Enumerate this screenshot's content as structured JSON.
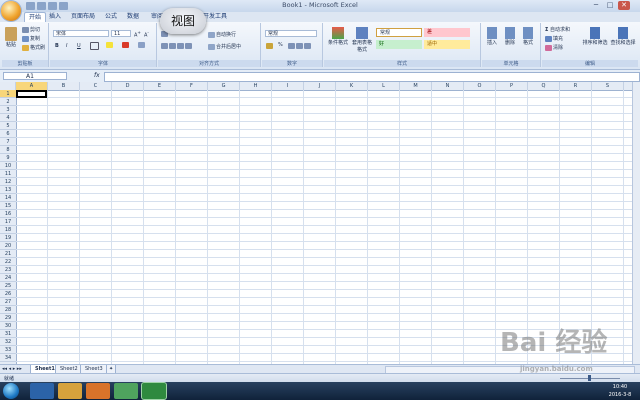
{
  "window": {
    "title": "Book1 - Microsoft Excel",
    "min": "─",
    "max": "□",
    "close": "✕"
  },
  "tabs": [
    "开始",
    "插入",
    "页面布局",
    "公式",
    "数据",
    "审阅",
    "视图",
    "开发工具"
  ],
  "tooltip": "视图",
  "ribbon": {
    "clipboard": {
      "paste": "粘贴",
      "cut": "剪切",
      "copy": "复制",
      "format_painter": "格式刷",
      "label": "剪贴板"
    },
    "font": {
      "name": "宋体",
      "size": "11",
      "bold": "B",
      "italic": "I",
      "underline": "U",
      "label": "字体"
    },
    "alignment": {
      "wrap": "自动换行",
      "merge": "合并后居中",
      "label": "对齐方式"
    },
    "number": {
      "format": "常规",
      "percent": "%",
      "label": "数字"
    },
    "styles": {
      "conditional": "条件格式",
      "table": "套用表格格式",
      "normal": "常规",
      "bad": "差",
      "good": "好",
      "neutral": "适中",
      "label": "样式"
    },
    "cells": {
      "insert": "插入",
      "delete": "删除",
      "format": "格式",
      "label": "单元格"
    },
    "editing": {
      "autosum": "自动求和",
      "fill": "填充",
      "clear": "清除",
      "sort": "排序和筛选",
      "find": "查找和选择",
      "label": "编辑"
    }
  },
  "formula_bar": {
    "name_box": "A1",
    "fx": "fx",
    "value": ""
  },
  "columns": [
    "A",
    "B",
    "C",
    "D",
    "E",
    "F",
    "G",
    "H",
    "I",
    "J",
    "K",
    "L",
    "M",
    "N",
    "O",
    "P",
    "Q",
    "R",
    "S"
  ],
  "rows": [
    "1",
    "2",
    "3",
    "4",
    "5",
    "6",
    "7",
    "8",
    "9",
    "10",
    "11",
    "12",
    "13",
    "14",
    "15",
    "16",
    "17",
    "18",
    "19",
    "20",
    "21",
    "22",
    "23",
    "24",
    "25",
    "26",
    "27",
    "28",
    "29",
    "30",
    "31",
    "32",
    "33",
    "34"
  ],
  "sheets": [
    "Sheet1",
    "Sheet2",
    "Sheet3"
  ],
  "status": {
    "ready": "就绪"
  },
  "taskbar": {
    "time": "10:40",
    "date": "2016-3-8"
  },
  "watermark": {
    "brand": "Bai 经验",
    "url": "jingyan.baidu.com"
  }
}
